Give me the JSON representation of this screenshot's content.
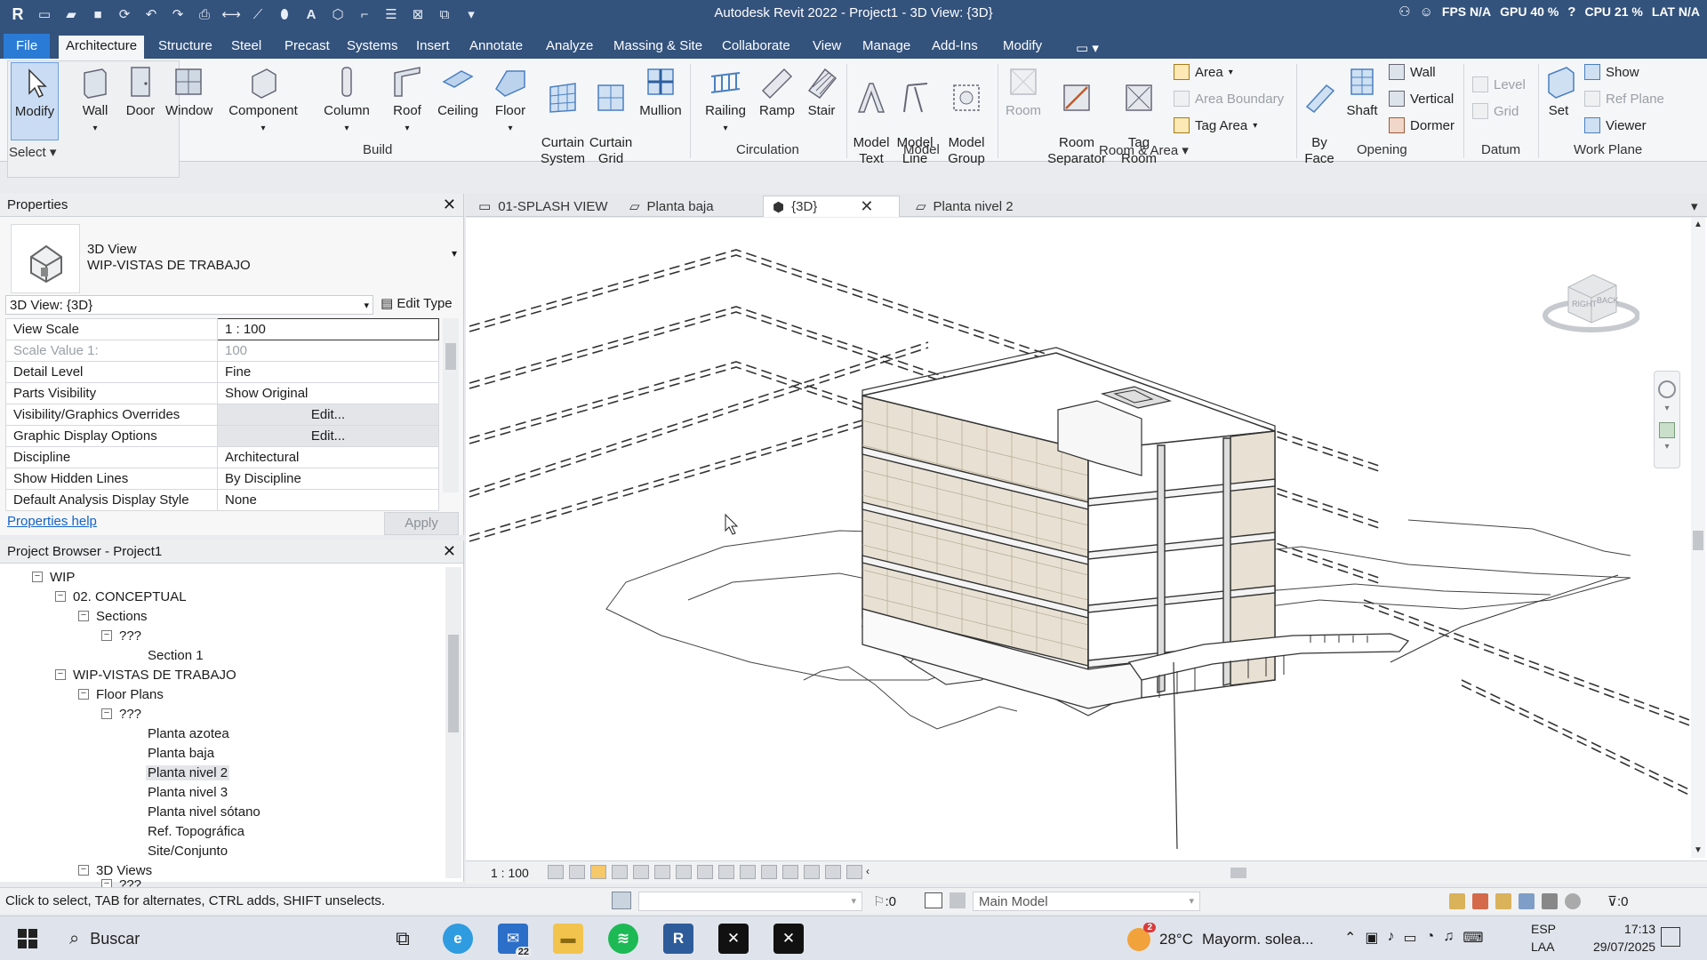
{
  "window": {
    "title": "Autodesk Revit 2022 - Project1 - 3D View: {3D}",
    "fps": "FPS  N/A",
    "gpu": "GPU  40 %",
    "cpu": "CPU  21 %",
    "lat": "LAT  N/A"
  },
  "tabs": [
    "File",
    "Architecture",
    "Structure",
    "Steel",
    "Precast",
    "Systems",
    "Insert",
    "Annotate",
    "Analyze",
    "Massing & Site",
    "Collaborate",
    "View",
    "Manage",
    "Add-Ins",
    "Modify"
  ],
  "ribbon": {
    "select": {
      "modify": "Modify",
      "label": "Select"
    },
    "build": {
      "wall": "Wall",
      "door": "Door",
      "window": "Window",
      "component": "Component",
      "column": "Column",
      "roof": "Roof",
      "ceiling": "Ceiling",
      "floor": "Floor",
      "curtain_system": "Curtain\nSystem",
      "curtain_grid": "Curtain\nGrid",
      "mullion": "Mullion",
      "label": "Build"
    },
    "circulation": {
      "railing": "Railing",
      "ramp": "Ramp",
      "stair": "Stair",
      "label": "Circulation"
    },
    "model": {
      "model_text": "Model\nText",
      "model_line": "Model\nLine",
      "model_group": "Model\nGroup",
      "label": "Model"
    },
    "room_area": {
      "room": "Room",
      "room_separator": "Room\nSeparator",
      "tag_room": "Tag\nRoom",
      "area": "Area",
      "area_boundary": "Area  Boundary",
      "tag_area": "Tag   Area",
      "label": "Room & Area"
    },
    "opening": {
      "by_face": "By\nFace",
      "shaft": "Shaft",
      "wall": "Wall",
      "vertical": "Vertical",
      "dormer": "Dormer",
      "label": "Opening"
    },
    "datum": {
      "level": "Level",
      "grid": "Grid",
      "label": "Datum"
    },
    "work_plane": {
      "set": "Set",
      "show": "Show",
      "ref_plane": "Ref  Plane",
      "viewer": "Viewer",
      "label": "Work Plane"
    }
  },
  "properties": {
    "title": "Properties",
    "type_family": "3D View",
    "type_name": "WIP-VISTAS DE TRABAJO",
    "instance": "3D View: {3D}",
    "edit_type": "Edit Type",
    "rows": [
      {
        "k": "View Scale",
        "v": "1 : 100"
      },
      {
        "k": "Scale Value    1:",
        "v": "100"
      },
      {
        "k": "Detail Level",
        "v": "Fine"
      },
      {
        "k": "Parts Visibility",
        "v": "Show Original"
      },
      {
        "k": "Visibility/Graphics Overrides",
        "v": "Edit..."
      },
      {
        "k": "Graphic Display Options",
        "v": "Edit..."
      },
      {
        "k": "Discipline",
        "v": "Architectural"
      },
      {
        "k": "Show Hidden Lines",
        "v": "By Discipline"
      },
      {
        "k": "Default Analysis Display Style",
        "v": "None"
      }
    ],
    "help": "Properties help",
    "apply": "Apply"
  },
  "browser": {
    "title": "Project Browser - Project1",
    "nodes": [
      "WIP",
      "02. CONCEPTUAL",
      "Sections",
      "???",
      "Section 1",
      "WIP-VISTAS DE TRABAJO",
      "Floor Plans",
      "???",
      "Planta azotea",
      "Planta baja",
      "Planta nivel 2",
      "Planta nivel 3",
      "Planta nivel sótano",
      "Ref. Topográfica",
      "Site/Conjunto",
      "3D Views",
      "???"
    ]
  },
  "view_tabs": [
    "01-SPLASH VIEW",
    "Planta baja",
    "{3D}",
    "Planta nivel 2"
  ],
  "viewcube": {
    "right": "RIGHT",
    "back": "BACK"
  },
  "view_control": {
    "scale": "1 : 100"
  },
  "status": {
    "message": "Click to select, TAB for alternates, CTRL adds, SHIFT unselects.",
    "zero1": ":0",
    "model": "Main Model",
    "zero2": ":0"
  },
  "taskbar": {
    "search": "Buscar",
    "mail_badge": "22",
    "weather_temp": "28°C",
    "weather_desc": "Mayorm. solea...",
    "weather_badge": "2",
    "lang1": "ESP",
    "lang2": "LAA",
    "time": "17:13",
    "date": "29/07/2025"
  },
  "colors": {
    "title_bar": "#33527c",
    "file_tab": "#2a7bd6",
    "link": "#1463c9",
    "facade": "#e8e1d3"
  }
}
